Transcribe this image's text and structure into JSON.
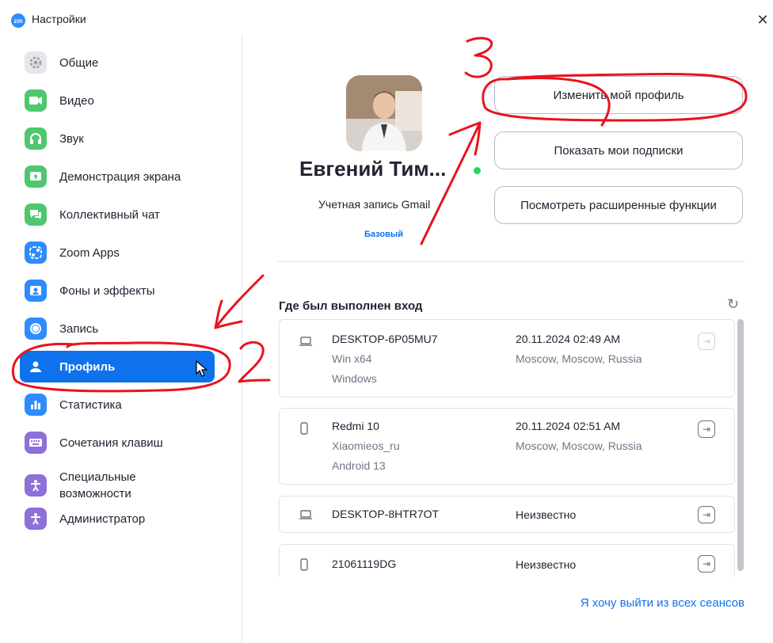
{
  "window": {
    "title": "Настройки",
    "logo_text": "zm",
    "close_glyph": "✕"
  },
  "sidebar": {
    "items": [
      {
        "label": "Общие",
        "icon": "gear-icon",
        "color": "#a0a0ab"
      },
      {
        "label": "Видео",
        "icon": "video-camera-icon",
        "color": "#4fc76e"
      },
      {
        "label": "Звук",
        "icon": "headphones-icon",
        "color": "#4fc76e"
      },
      {
        "label": "Демонстрация экрана",
        "icon": "share-screen-icon",
        "color": "#4fc76e"
      },
      {
        "label": "Коллективный чат",
        "icon": "chat-icon",
        "color": "#4fc76e"
      },
      {
        "label": "Zoom Apps",
        "icon": "apps-icon",
        "color": "#2d8cff"
      },
      {
        "label": "Фоны и эффекты",
        "icon": "background-icon",
        "color": "#2d8cff"
      },
      {
        "label": "Запись",
        "icon": "record-icon",
        "color": "#2d8cff"
      },
      {
        "label": "Профиль",
        "icon": "user-icon",
        "color": "#0e72ed",
        "active": true
      },
      {
        "label": "Статистика",
        "icon": "statistics-icon",
        "color": "#2d8cff"
      },
      {
        "label": "Сочетания клавиш",
        "icon": "keyboard-icon",
        "color": "#8f6fd8"
      },
      {
        "label": "Специальные возможности",
        "icon": "accessibility-icon",
        "color": "#8f6fd8"
      },
      {
        "label": "Администратор",
        "icon": "admin-icon",
        "color": "#8f6fd8"
      }
    ]
  },
  "profile": {
    "name": "Евгений Тим...",
    "account_type": "Учетная запись Gmail",
    "plan": "Базовый",
    "status": "online"
  },
  "buttons": {
    "edit_profile": "Изменить мой профиль",
    "subscriptions": "Показать мои подписки",
    "advanced": "Посмотреть расширенные функции"
  },
  "sessions": {
    "title": "Где был выполнен вход",
    "refresh_icon": "↻",
    "items": [
      {
        "device": "DESKTOP-6P05MU7",
        "sub1": "Win x64",
        "sub2": "Windows",
        "time": "20.11.2024 02:49 AM",
        "location": "Moscow, Moscow, Russia",
        "kind": "laptop",
        "logout_enabled": false
      },
      {
        "device": "Redmi 10",
        "sub1": "Xiaomieos_ru",
        "sub2": "Android 13",
        "time": "20.11.2024 02:51 AM",
        "location": "Moscow, Moscow, Russia",
        "kind": "phone",
        "logout_enabled": true
      },
      {
        "device": "DESKTOP-8HTR7OT",
        "time": "Неизвестно",
        "kind": "laptop",
        "logout_enabled": true
      },
      {
        "device": "21061119DG",
        "time": "Неизвестно",
        "kind": "phone",
        "logout_enabled": true
      }
    ],
    "logout_all": "Я хочу выйти из всех сеансов"
  },
  "annotations": {
    "mark2": "2",
    "mark3": "3",
    "color": "#e8141c"
  }
}
